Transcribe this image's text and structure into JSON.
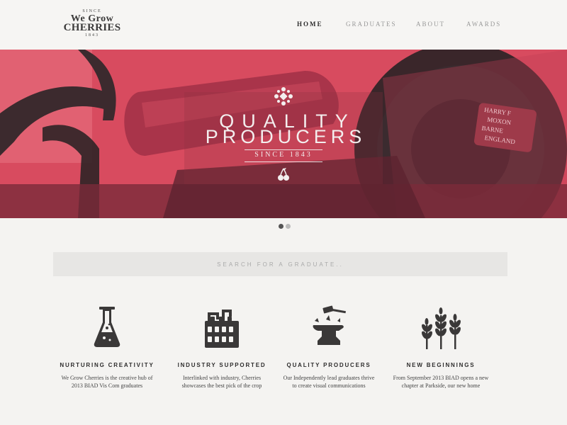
{
  "logo": {
    "since": "SINCE",
    "line1": "We Grow",
    "line2": "CHERRIES",
    "year": "1843"
  },
  "nav": {
    "items": [
      {
        "label": "HOME",
        "active": true
      },
      {
        "label": "GRADUATES",
        "active": false
      },
      {
        "label": "ABOUT",
        "active": false
      },
      {
        "label": "AWARDS",
        "active": false
      }
    ]
  },
  "hero": {
    "title_line1": "QUALITY",
    "title_line2": "PRODUCERS",
    "since": "SINCE 1843",
    "plate_text": [
      "HARRY F",
      "MOXON",
      "BARNE",
      "ENGLAND"
    ],
    "tint_color": "#d94a5e"
  },
  "slider": {
    "active_slide": 1,
    "total_slides": 2
  },
  "search": {
    "placeholder": "SEARCH FOR A GRADUATE.."
  },
  "features": [
    {
      "icon": "flask-icon",
      "title": "NURTURING CREATIVITY",
      "desc_line1": "We Grow Cherries is the creative hub of",
      "desc_line2": "2013 BIAD Vis Com graduates"
    },
    {
      "icon": "factory-icon",
      "title": "INDUSTRY SUPPORTED",
      "desc_line1": "Interlinked with industry, Cherries",
      "desc_line2": "showcases the best pick of the crop"
    },
    {
      "icon": "anvil-icon",
      "title": "QUALITY PRODUCERS",
      "desc_line1": "Our Independently lead graduates thrive",
      "desc_line2": "to create visual communications"
    },
    {
      "icon": "wheat-icon",
      "title": "NEW BEGINNINGS",
      "desc_line1": "From September 2013 BIAD opens a new",
      "desc_line2": "chapter at Parkside, our new home"
    }
  ],
  "colors": {
    "accent": "#d94a5e",
    "dark": "#3a3838",
    "background": "#f4f3f1"
  }
}
